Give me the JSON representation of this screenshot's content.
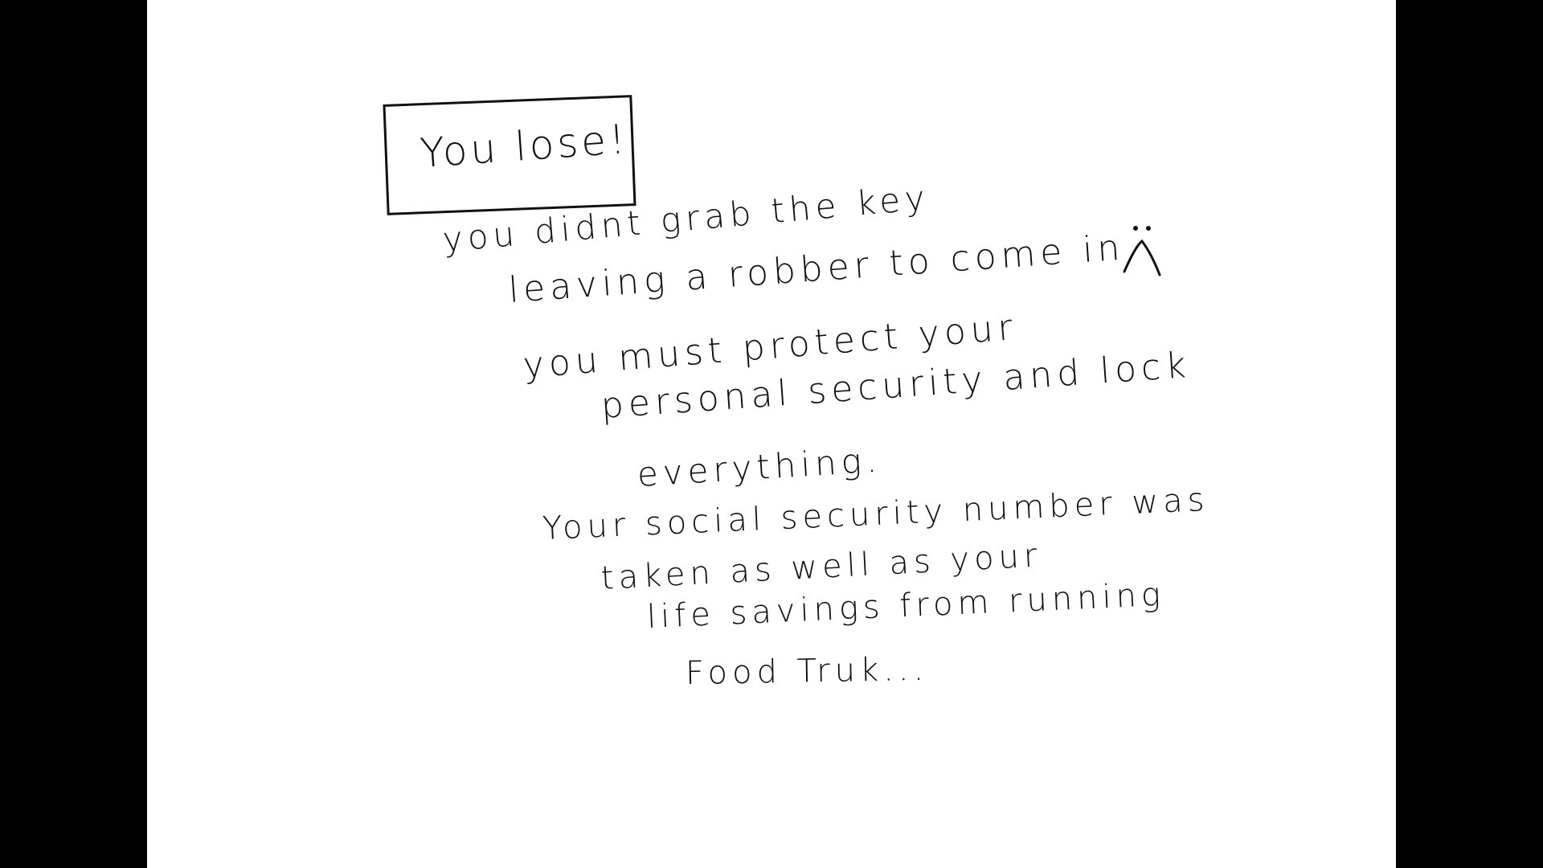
{
  "dialog": {
    "title": "You lose!",
    "lines": [
      "you didnt grab the key",
      "leaving a robber to come in.",
      "you must protect your",
      "personal security and lock",
      "everything.",
      "Your social security number was",
      "taken as well as your",
      "life savings from running",
      "Food Truk..."
    ],
    "face_icon": "sad-face-icon"
  },
  "colors": {
    "background": "#ffffff",
    "letterbox": "#000000",
    "ink": "#111111"
  }
}
